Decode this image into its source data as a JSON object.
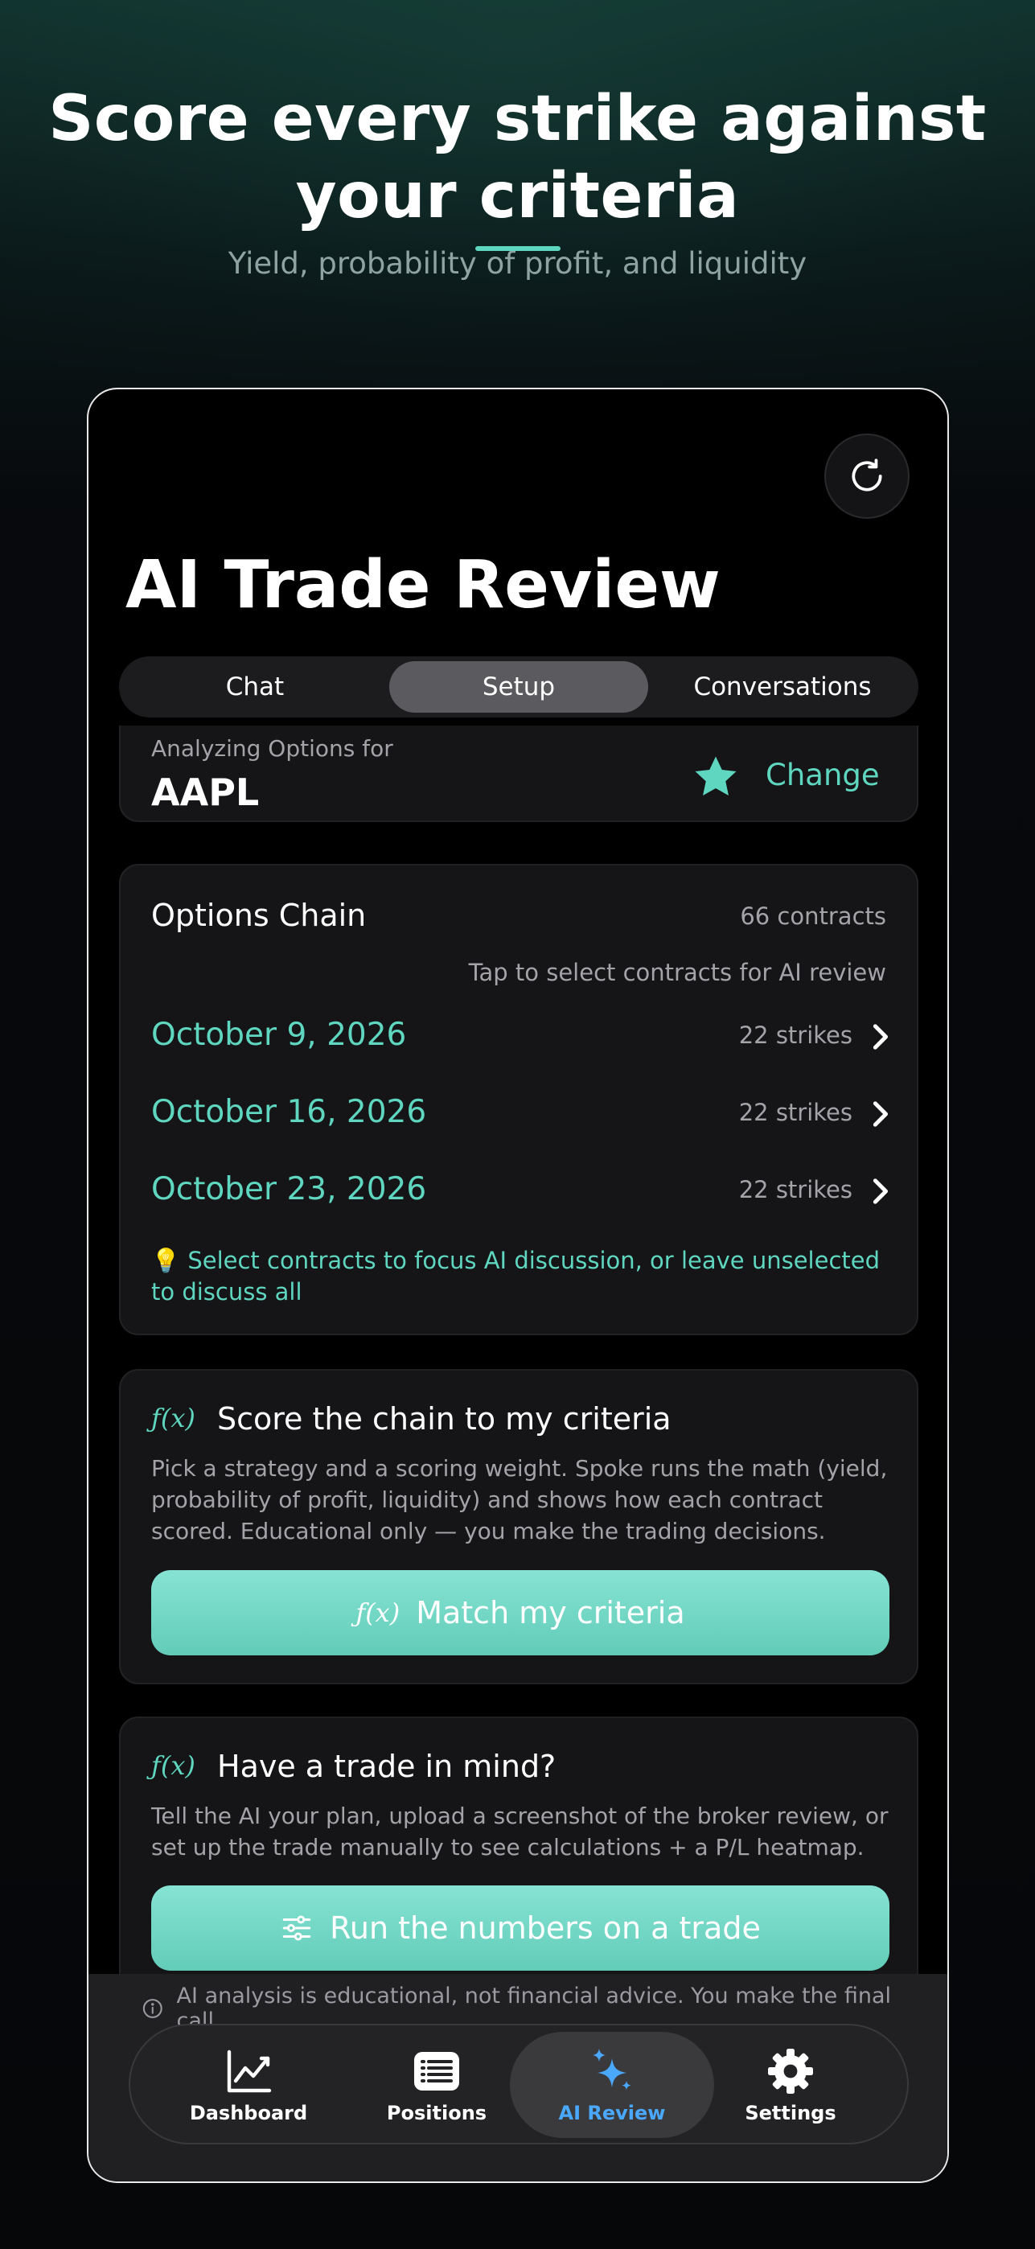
{
  "hero": {
    "title_line1": "Score every strike against",
    "title_line2": "your criteria",
    "subtitle": "Yield, probability of profit, and liquidity"
  },
  "screen": {
    "title": "AI Trade Review",
    "tabs": [
      "Chat",
      "Setup",
      "Conversations"
    ],
    "active_tab": "Setup"
  },
  "symbol": {
    "label": "Analyzing Options for",
    "ticker": "AAPL",
    "change_label": "Change"
  },
  "chain": {
    "title": "Options Chain",
    "count": "66 contracts",
    "hint": "Tap to select contracts for AI review",
    "expirations": [
      {
        "date": "October 9, 2026",
        "strikes": "22 strikes"
      },
      {
        "date": "October 16, 2026",
        "strikes": "22 strikes"
      },
      {
        "date": "October 23, 2026",
        "strikes": "22 strikes"
      }
    ],
    "tip": "💡 Select contracts to focus AI discussion, or leave unselected to discuss all"
  },
  "score_section": {
    "icon": "ƒ(x)",
    "title": "Score the chain to my criteria",
    "description": "Pick a strategy and a scoring weight. Spoke runs the math (yield, probability of profit, liquidity) and shows how each contract scored. Educational only — you make the trading decisions.",
    "button_label": "Match my criteria"
  },
  "trade_section": {
    "icon": "ƒ(x)",
    "title": "Have a trade in mind?",
    "description": "Tell the AI your plan, upload a screenshot of the broker review, or set up the trade manually to see calculations + a P/L heatmap.",
    "button_label": "Run the numbers on a trade"
  },
  "disclaimer": "AI analysis is educational, not financial advice. You make the final call.",
  "tabbar": {
    "items": [
      {
        "label": "Dashboard",
        "icon": "chart-icon"
      },
      {
        "label": "Positions",
        "icon": "list-icon"
      },
      {
        "label": "AI Review",
        "icon": "sparkles-icon"
      },
      {
        "label": "Settings",
        "icon": "gear-icon"
      }
    ],
    "active": "AI Review"
  },
  "colors": {
    "accent": "#5fd6bf",
    "active_tab": "#4aa9ff",
    "background": "#000000"
  }
}
